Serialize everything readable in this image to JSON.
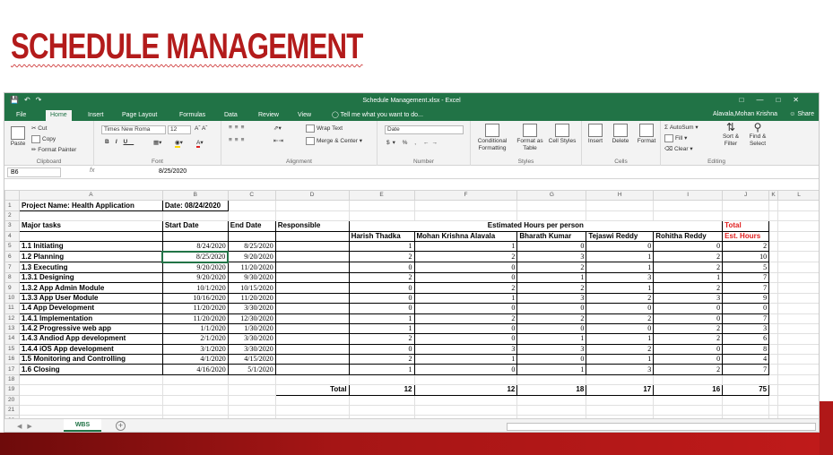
{
  "slide": {
    "title": "SCHEDULE MANAGEMENT"
  },
  "window": {
    "title": "Schedule Management.xlsx - Excel",
    "user": "Alavala,Mohan Krishna",
    "share": "Share"
  },
  "menu": {
    "tabs": [
      "File",
      "Home",
      "Insert",
      "Page Layout",
      "Formulas",
      "Data",
      "Review",
      "View"
    ],
    "tell_me": "Tell me what you want to do..."
  },
  "ribbon": {
    "clipboard": {
      "name": "Clipboard",
      "paste": "Paste",
      "cut": "Cut",
      "copy": "Copy",
      "format_painter": "Format Painter"
    },
    "font": {
      "name": "Font",
      "family": "Times New Roma",
      "size": "12"
    },
    "alignment": {
      "name": "Alignment",
      "wrap": "Wrap Text",
      "merge": "Merge & Center"
    },
    "number": {
      "name": "Number",
      "format": "Date"
    },
    "styles": {
      "name": "Styles",
      "conditional": "Conditional Formatting",
      "format_table": "Format as Table",
      "cell_styles": "Cell Styles"
    },
    "cells": {
      "name": "Cells",
      "insert": "Insert",
      "delete": "Delete",
      "format": "Format"
    },
    "editing": {
      "name": "Editing",
      "autosum": "AutoSum",
      "fill": "Fill",
      "clear": "Clear",
      "sort": "Sort & Filter",
      "find": "Find & Select"
    }
  },
  "formula_bar": {
    "name_box": "B6",
    "fx": "fx",
    "value": "8/25/2020"
  },
  "grid": {
    "columns": [
      "A",
      "B",
      "C",
      "D",
      "E",
      "F",
      "G",
      "H",
      "I",
      "J",
      "K",
      "L"
    ],
    "project_name": "Project Name: Health Application",
    "date_label": "Date: 08/24/2020",
    "headers": {
      "tasks": "Major tasks",
      "start": "Start Date",
      "end": "End Date",
      "resp": "Responsible",
      "est": "Estimated Hours per person",
      "total": "Total",
      "est_hours": "Est. Hours"
    },
    "people": [
      "Harish Thadka",
      "Mohan Krishna Alavala",
      "Bharath Kumar",
      "Tejaswi Reddy",
      "Rohitha Reddy"
    ],
    "tasks": [
      {
        "name": "1.1 Initiating",
        "start": "8/24/2020",
        "end": "8/25/2020",
        "h": [
          "1",
          "1",
          "0",
          "0",
          "0"
        ],
        "total": "2"
      },
      {
        "name": "1.2 Planning",
        "start": "8/25/2020",
        "end": "9/20/2020",
        "h": [
          "2",
          "2",
          "3",
          "1",
          "2"
        ],
        "total": "10"
      },
      {
        "name": "1.3 Executing",
        "start": "9/20/2020",
        "end": "11/20/2020",
        "h": [
          "0",
          "0",
          "2",
          "1",
          "2"
        ],
        "total": "5"
      },
      {
        "name": "1.3.1 Designing",
        "start": "9/20/2020",
        "end": "9/30/2020",
        "h": [
          "2",
          "0",
          "1",
          "3",
          "1"
        ],
        "total": "7"
      },
      {
        "name": "1.3.2 App Admin Module",
        "start": "10/1/2020",
        "end": "10/15/2020",
        "h": [
          "0",
          "2",
          "2",
          "1",
          "2"
        ],
        "total": "7"
      },
      {
        "name": "1.3.3 App User Module",
        "start": "10/16/2020",
        "end": "11/20/2020",
        "h": [
          "0",
          "1",
          "3",
          "2",
          "3"
        ],
        "total": "9"
      },
      {
        "name": "1.4 App Development",
        "start": "11/20/2020",
        "end": "3/30/2020",
        "h": [
          "0",
          "0",
          "0",
          "0",
          "0"
        ],
        "total": "0"
      },
      {
        "name": "1.4.1 Implementation",
        "start": "11/20/2020",
        "end": "12/30/2020",
        "h": [
          "1",
          "2",
          "2",
          "2",
          "0"
        ],
        "total": "7"
      },
      {
        "name": "1.4.2 Progressive web app",
        "start": "1/1/2020",
        "end": "1/30/2020",
        "h": [
          "1",
          "0",
          "0",
          "0",
          "2"
        ],
        "total": "3"
      },
      {
        "name": "1.4.3 Andiod App development",
        "start": "2/1/2020",
        "end": "3/30/2020",
        "h": [
          "2",
          "0",
          "1",
          "1",
          "2"
        ],
        "total": "6"
      },
      {
        "name": "1.4.4 iOS App development",
        "start": "3/1/2020",
        "end": "3/30/2020",
        "h": [
          "0",
          "3",
          "3",
          "2",
          "0"
        ],
        "total": "8"
      },
      {
        "name": "1.5 Monitoring and Controlling",
        "start": "4/1/2020",
        "end": "4/15/2020",
        "h": [
          "2",
          "1",
          "0",
          "1",
          "0"
        ],
        "total": "4"
      },
      {
        "name": "1.6 Closing",
        "start": "4/16/2020",
        "end": "5/1/2020",
        "h": [
          "1",
          "0",
          "1",
          "3",
          "2"
        ],
        "total": "7"
      }
    ],
    "totals_label": "Total",
    "totals": [
      "12",
      "12",
      "18",
      "17",
      "16",
      "75"
    ]
  },
  "sheet_tab": "WBS",
  "colors": {
    "excel_green": "#217346",
    "title_red": "#b31b1b",
    "accent_red": "#e02020"
  }
}
